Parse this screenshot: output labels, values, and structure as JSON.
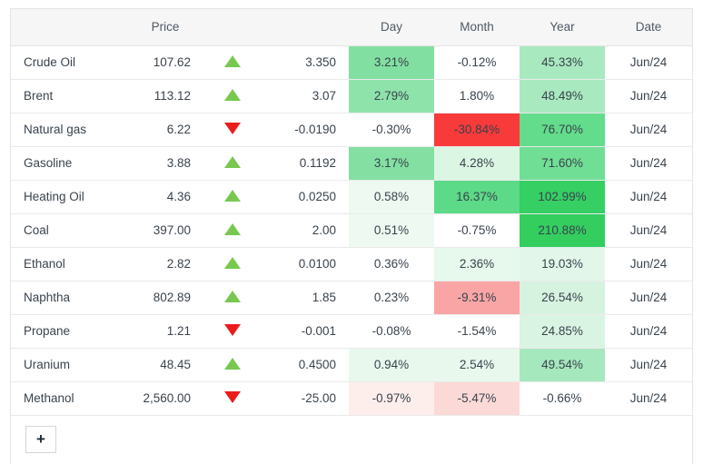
{
  "table": {
    "columns": [
      {
        "key": "name",
        "label": ""
      },
      {
        "key": "price",
        "label": "Price"
      },
      {
        "key": "arrow",
        "label": ""
      },
      {
        "key": "change",
        "label": ""
      },
      {
        "key": "day",
        "label": "Day"
      },
      {
        "key": "month",
        "label": "Month"
      },
      {
        "key": "year",
        "label": "Year"
      },
      {
        "key": "date",
        "label": "Date"
      }
    ],
    "rows": [
      {
        "name": "Crude Oil",
        "price": "107.62",
        "direction": "up",
        "change": "3.350",
        "day": {
          "text": "3.21%",
          "fill": "#81e0a1"
        },
        "month": {
          "text": "-0.12%",
          "fill": "transparent"
        },
        "year": {
          "text": "45.33%",
          "fill": "#a9e9bf"
        },
        "date": "Jun/24"
      },
      {
        "name": "Brent",
        "price": "113.12",
        "direction": "up",
        "change": "3.07",
        "day": {
          "text": "2.79%",
          "fill": "#8ee3ab"
        },
        "month": {
          "text": "1.80%",
          "fill": "transparent"
        },
        "year": {
          "text": "48.49%",
          "fill": "#a9e9bf"
        },
        "date": "Jun/24"
      },
      {
        "name": "Natural gas",
        "price": "6.22",
        "direction": "down",
        "change": "-0.0190",
        "day": {
          "text": "-0.30%",
          "fill": "transparent"
        },
        "month": {
          "text": "-30.84%",
          "fill": "#f83a3a"
        },
        "year": {
          "text": "76.70%",
          "fill": "#63dc8b"
        },
        "date": "Jun/24"
      },
      {
        "name": "Gasoline",
        "price": "3.88",
        "direction": "up",
        "change": "0.1192",
        "day": {
          "text": "3.17%",
          "fill": "#83e0a2"
        },
        "month": {
          "text": "4.28%",
          "fill": "#dcf6e4"
        },
        "year": {
          "text": "71.60%",
          "fill": "#70de94"
        },
        "date": "Jun/24"
      },
      {
        "name": "Heating Oil",
        "price": "4.36",
        "direction": "up",
        "change": "0.0250",
        "day": {
          "text": "0.58%",
          "fill": "#eefaf1"
        },
        "month": {
          "text": "16.37%",
          "fill": "#5cda87"
        },
        "year": {
          "text": "102.99%",
          "fill": "#35cf63"
        },
        "date": "Jun/24"
      },
      {
        "name": "Coal",
        "price": "397.00",
        "direction": "up",
        "change": "2.00",
        "day": {
          "text": "0.51%",
          "fill": "#eefaf1"
        },
        "month": {
          "text": "-0.75%",
          "fill": "transparent"
        },
        "year": {
          "text": "210.88%",
          "fill": "#33ce5e"
        },
        "date": "Jun/24"
      },
      {
        "name": "Ethanol",
        "price": "2.82",
        "direction": "up",
        "change": "0.0100",
        "day": {
          "text": "0.36%",
          "fill": "transparent"
        },
        "month": {
          "text": "2.36%",
          "fill": "#e7f8ec"
        },
        "year": {
          "text": "19.03%",
          "fill": "#e2f7e9"
        },
        "date": "Jun/24"
      },
      {
        "name": "Naphtha",
        "price": "802.89",
        "direction": "up",
        "change": "1.85",
        "day": {
          "text": "0.23%",
          "fill": "transparent"
        },
        "month": {
          "text": "-9.31%",
          "fill": "#f9a5a5"
        },
        "year": {
          "text": "26.54%",
          "fill": "#d6f3e0"
        },
        "date": "Jun/24"
      },
      {
        "name": "Propane",
        "price": "1.21",
        "direction": "down",
        "change": "-0.001",
        "day": {
          "text": "-0.08%",
          "fill": "transparent"
        },
        "month": {
          "text": "-1.54%",
          "fill": "transparent"
        },
        "year": {
          "text": "24.85%",
          "fill": "#d9f4e2"
        },
        "date": "Jun/24"
      },
      {
        "name": "Uranium",
        "price": "48.45",
        "direction": "up",
        "change": "0.4500",
        "day": {
          "text": "0.94%",
          "fill": "#e8f8ed"
        },
        "month": {
          "text": "2.54%",
          "fill": "#e8f8ed"
        },
        "year": {
          "text": "49.54%",
          "fill": "#a6e8bd"
        },
        "date": "Jun/24"
      },
      {
        "name": "Methanol",
        "price": "2,560.00",
        "direction": "down",
        "change": "-25.00",
        "day": {
          "text": "-0.97%",
          "fill": "#fdeeec"
        },
        "month": {
          "text": "-5.47%",
          "fill": "#fbd9d7"
        },
        "year": {
          "text": "-0.66%",
          "fill": "transparent"
        },
        "date": "Jun/24"
      }
    ]
  },
  "footer": {
    "add_label": "+"
  },
  "colors": {
    "arrow_up": "#78c850",
    "arrow_down": "#ea1c1c",
    "header_bg": "#f6f6f6",
    "border": "#e4e4e4"
  }
}
